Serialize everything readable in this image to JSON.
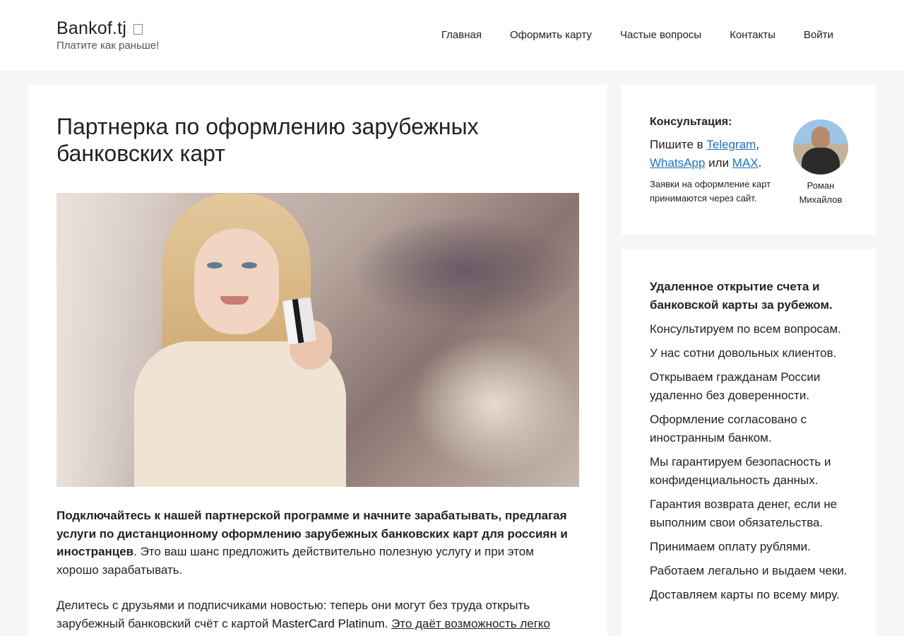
{
  "header": {
    "site_name": "Bankof.tj",
    "tagline": "Платите как раньше!",
    "nav": [
      "Главная",
      "Оформить карту",
      "Частые вопросы",
      "Контакты",
      "Войти"
    ]
  },
  "article": {
    "title": "Партнерка по оформлению зарубежных банковских карт",
    "lead_bold": "Подключайтесь к нашей партнерской программе и начните зарабатывать, предлагая услуги по дистанционному оформлению зарубежных банковских карт для россиян и иностранцев",
    "lead_rest": ". Это ваш шанс предложить действительно полезную услугу и при этом хорошо зарабатывать.",
    "para2_text": "Делитесь с друзьями и подписчиками новостью: теперь они могут без труда открыть зарубежный банковский счёт с картой ",
    "para2_brand": "MasterCard Platinum",
    "para2_sep": ". ",
    "para2_link": "Это даёт возможность легко"
  },
  "consult": {
    "label": "Консультация:",
    "write_prefix": "Пишите в ",
    "telegram": "Telegram",
    "comma": ",",
    "whatsapp": "WhatsApp",
    "or": " или ",
    "max": "MAX",
    "period": ".",
    "note": "Заявки на оформление карт принимаются через сайт.",
    "person_name": "Роман Михайлов"
  },
  "features": {
    "title": "Удаленное открытие счета и банковской карты за рубежом.",
    "items": [
      "Консультируем по всем вопросам.",
      "У нас сотни довольных клиентов.",
      "Открываем гражданам России удаленно без доверенности.",
      "Оформление согласовано с иностранным банком.",
      "Мы гарантируем безопасность и конфиденциальность данных.",
      "Гарантия возврата денег, если не выполним свои обязательства.",
      "Принимаем оплату рублями.",
      "Работаем легально и выдаем чеки.",
      "Доставляем карты по всему миру."
    ]
  },
  "colors": {
    "link": "#1e73be",
    "page_bg": "#f5f6f8",
    "card_bg": "#ffffff"
  }
}
